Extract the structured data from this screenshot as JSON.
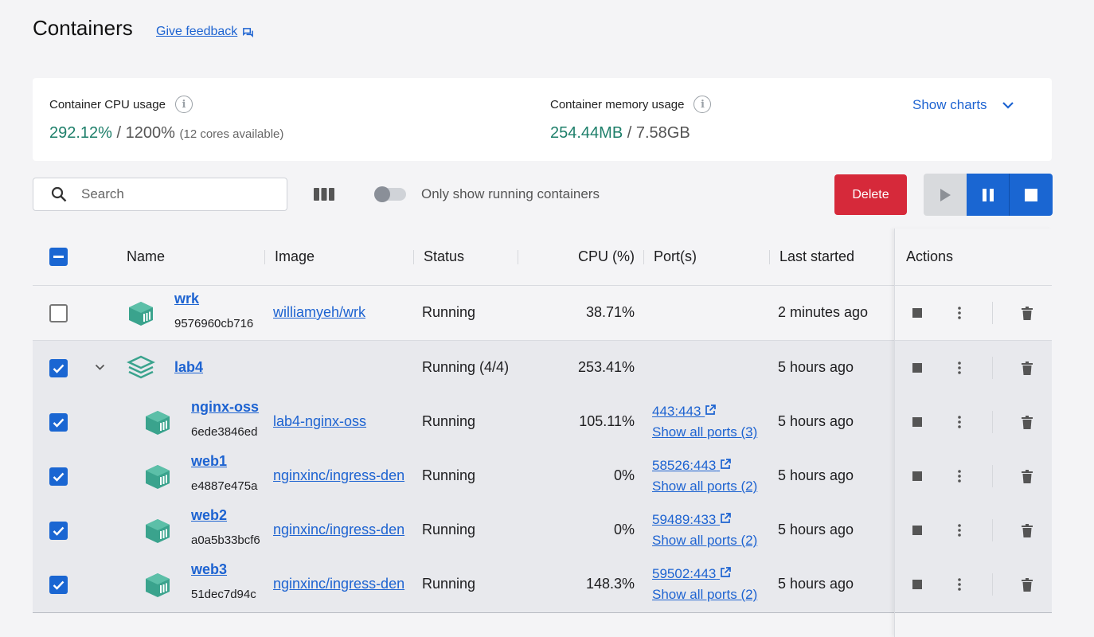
{
  "page": {
    "title": "Containers",
    "feedback": "Give feedback"
  },
  "stats": {
    "cpu": {
      "label": "Container CPU usage",
      "used": "292.12%",
      "sep": " / ",
      "total": "1200%",
      "note": "(12 cores available)"
    },
    "memory": {
      "label": "Container memory usage",
      "used": "254.44MB",
      "sep": " / ",
      "total": "7.58GB"
    },
    "show_charts": "Show charts"
  },
  "toolbar": {
    "search_placeholder": "Search",
    "toggle_label": "Only show running containers",
    "delete_label": "Delete"
  },
  "table": {
    "headers": {
      "name": "Name",
      "image": "Image",
      "status": "Status",
      "cpu": "CPU (%)",
      "ports": "Port(s)",
      "last_started": "Last started",
      "actions": "Actions"
    },
    "rows": [
      {
        "name": "wrk",
        "id": "9576960cb716",
        "image": "williamyeh/wrk",
        "status": "Running",
        "cpu": "38.71%",
        "port": "",
        "show_ports": "",
        "last_started": "2 minutes ago",
        "checked": false
      },
      {
        "name": "lab4",
        "id": "",
        "image": "",
        "status": "Running (4/4)",
        "cpu": "253.41%",
        "port": "",
        "show_ports": "",
        "last_started": "5 hours ago",
        "checked": true
      },
      {
        "name": "nginx-oss",
        "id": "6ede3846ed",
        "image": "lab4-nginx-oss",
        "status": "Running",
        "cpu": "105.11%",
        "port": "443:443",
        "show_ports": "Show all ports (3)",
        "last_started": "5 hours ago",
        "checked": true
      },
      {
        "name": "web1",
        "id": "e4887e475a",
        "image": "nginxinc/ingress-den",
        "status": "Running",
        "cpu": "0%",
        "port": "58526:443",
        "show_ports": "Show all ports (2)",
        "last_started": "5 hours ago",
        "checked": true
      },
      {
        "name": "web2",
        "id": "a0a5b33bcf6",
        "image": "nginxinc/ingress-den",
        "status": "Running",
        "cpu": "0%",
        "port": "59489:433",
        "show_ports": "Show all ports (2)",
        "last_started": "5 hours ago",
        "checked": true
      },
      {
        "name": "web3",
        "id": "51dec7d94c",
        "image": "nginxinc/ingress-den",
        "status": "Running",
        "cpu": "148.3%",
        "port": "59502:443",
        "show_ports": "Show all ports (2)",
        "last_started": "5 hours ago",
        "checked": true
      }
    ]
  },
  "colors": {
    "accent": "#1a66d2",
    "delete": "#d6293a",
    "metric": "#1e7f6a",
    "container_icon": "#3aa38d"
  }
}
